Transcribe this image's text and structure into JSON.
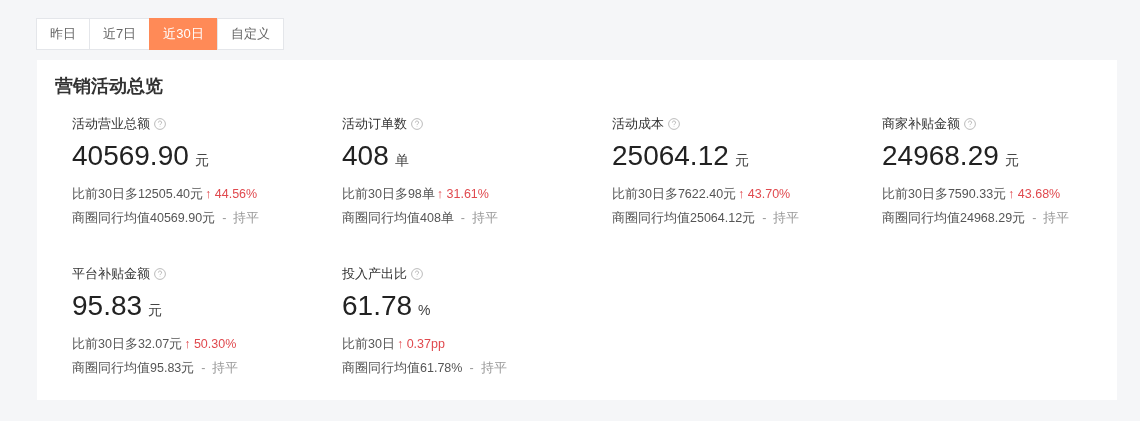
{
  "tabs": [
    {
      "label": "昨日",
      "selected": false
    },
    {
      "label": "近7日",
      "selected": false
    },
    {
      "label": "近30日",
      "selected": true
    },
    {
      "label": "自定义",
      "selected": false
    }
  ],
  "panel": {
    "title": "营销活动总览",
    "metrics": [
      {
        "label": "活动营业总额",
        "value": "40569.90",
        "unit": "元",
        "compare": "比前30日多12505.40元",
        "change": "↑ 44.56%",
        "kind": "increase",
        "average": "商圈同行均值40569.90元",
        "separator": "-",
        "status": "持平"
      },
      {
        "label": "活动订单数",
        "value": "408",
        "unit": "单",
        "compare": "比前30日多98单",
        "change": "↑ 31.61%",
        "kind": "increase",
        "average": "商圈同行均值408单",
        "separator": "-",
        "status": "持平"
      },
      {
        "label": "活动成本",
        "value": "25064.12",
        "unit": "元",
        "compare": "比前30日多7622.40元",
        "change": "↑ 43.70%",
        "kind": "increase",
        "average": "商圈同行均值25064.12元",
        "separator": "-",
        "status": "持平"
      },
      {
        "label": "商家补贴金额",
        "value": "24968.29",
        "unit": "元",
        "compare": "比前30日多7590.33元",
        "change": "↑ 43.68%",
        "kind": "increase",
        "average": "商圈同行均值24968.29元",
        "separator": "-",
        "status": "持平"
      },
      {
        "label": "平台补贴金额",
        "value": "95.83",
        "unit": "元",
        "compare": "比前30日多32.07元",
        "change": "↑ 50.30%",
        "kind": "increase",
        "average": "商圈同行均值95.83元",
        "separator": "-",
        "status": "持平"
      },
      {
        "label": "投入产出比",
        "value": "61.78",
        "unit": "%",
        "compare": "比前30日",
        "change": "↑ 0.37pp",
        "kind": "increase",
        "average": "商圈同行均值61.78%",
        "separator": "-",
        "status": "持平"
      }
    ]
  }
}
